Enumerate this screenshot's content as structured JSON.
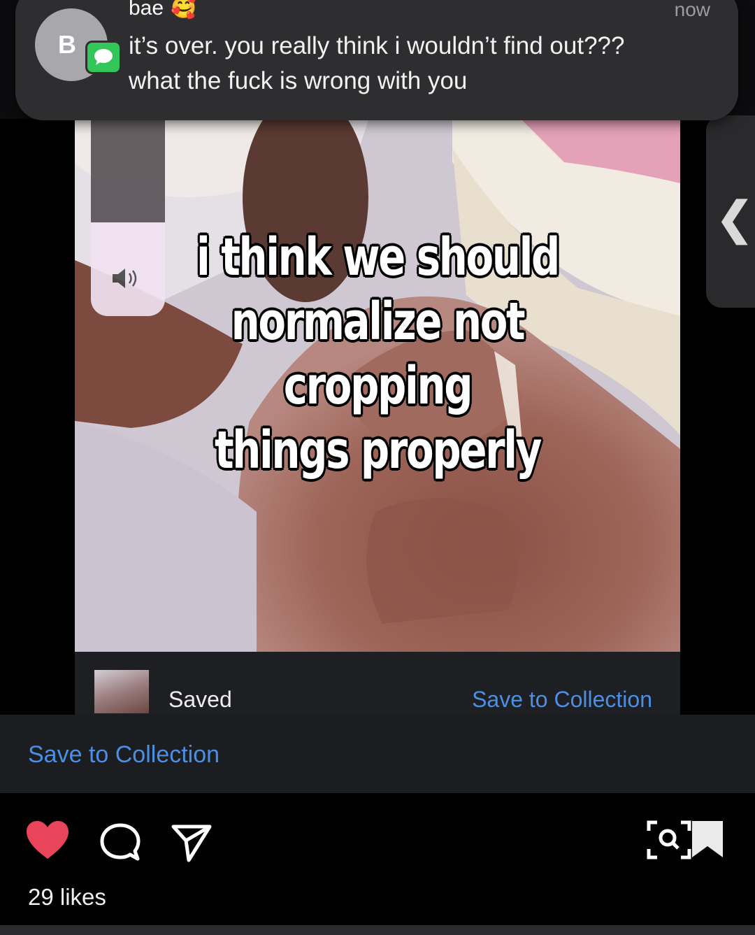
{
  "notification": {
    "avatar_initial": "B",
    "sender": "bae",
    "sender_emoji": "🥰",
    "time": "now",
    "line1": "it’s over. you really think i wouldn’t find out???",
    "line2": "what the fuck is wrong with you"
  },
  "post": {
    "meme_line1": "i think we should",
    "meme_line2": "normalize not cropping",
    "meme_line3": "things properly"
  },
  "volume": {
    "icon": "speaker-icon",
    "level": 0.48
  },
  "edge_panel": {
    "icon": "chevron-left-icon",
    "glyph": "❮"
  },
  "saved_bar": {
    "label": "Saved",
    "link": "Save to Collection"
  },
  "collection_bar": {
    "link": "Save to Collection"
  },
  "actions": {
    "like_icon": "heart-icon",
    "comment_icon": "comment-icon",
    "share_icon": "send-icon",
    "lens_icon": "visual-search-icon",
    "bookmark_icon": "bookmark-icon",
    "liked": true,
    "likes": "29 likes"
  },
  "colors": {
    "link_blue": "#4a8fe3",
    "heart_red": "#e8455a",
    "messages_green": "#33c759"
  }
}
